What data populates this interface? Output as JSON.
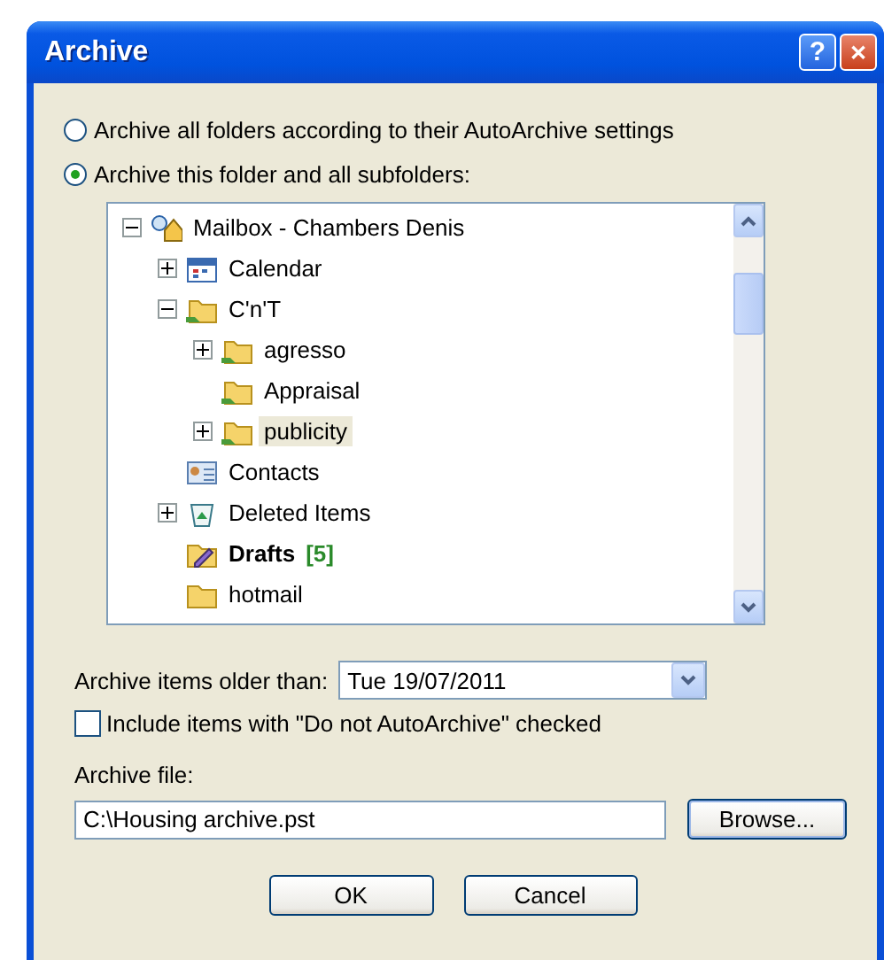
{
  "window": {
    "title": "Archive"
  },
  "title_buttons": [
    {
      "kind": "help",
      "label": "?"
    },
    {
      "kind": "close",
      "label": "✕"
    }
  ],
  "scope_options": [
    {
      "label": "Archive all folders according to their AutoArchive settings",
      "selected": false
    },
    {
      "label": "Archive this folder and all subfolders:",
      "selected": true
    }
  ],
  "folder_tree": [
    {
      "label": "Mailbox - Chambers Denis",
      "kind": "mailbox",
      "expanded": true,
      "selected": false,
      "children": [
        {
          "label": "Calendar",
          "kind": "calendar",
          "expanded": false,
          "selected": false
        },
        {
          "label": "C'n'T",
          "kind": "shared-folder",
          "expanded": true,
          "selected": false,
          "children": [
            {
              "label": "agresso",
              "kind": "shared-folder",
              "expanded": false,
              "selected": false
            },
            {
              "label": "Appraisal",
              "kind": "shared-folder",
              "selected": false
            },
            {
              "label": "publicity",
              "kind": "shared-folder",
              "expanded": false,
              "selected": true
            }
          ]
        },
        {
          "label": "Contacts",
          "kind": "contacts",
          "selected": false
        },
        {
          "label": "Deleted Items",
          "kind": "deleted",
          "expanded": false,
          "selected": false
        },
        {
          "label": "Drafts",
          "kind": "drafts",
          "count": "[5]",
          "selected": false
        },
        {
          "label": "hotmail",
          "kind": "folder",
          "selected": false
        }
      ]
    }
  ],
  "older_than": {
    "label": "Archive items older than:",
    "value": "Tue 19/07/2011"
  },
  "include_checkbox": {
    "label": "Include items with \"Do not AutoArchive\" checked",
    "checked": false
  },
  "archive_file": {
    "label": "Archive file:",
    "value": "C:\\Housing archive.pst",
    "browse": "Browse..."
  },
  "buttons": [
    "OK",
    "Cancel"
  ]
}
